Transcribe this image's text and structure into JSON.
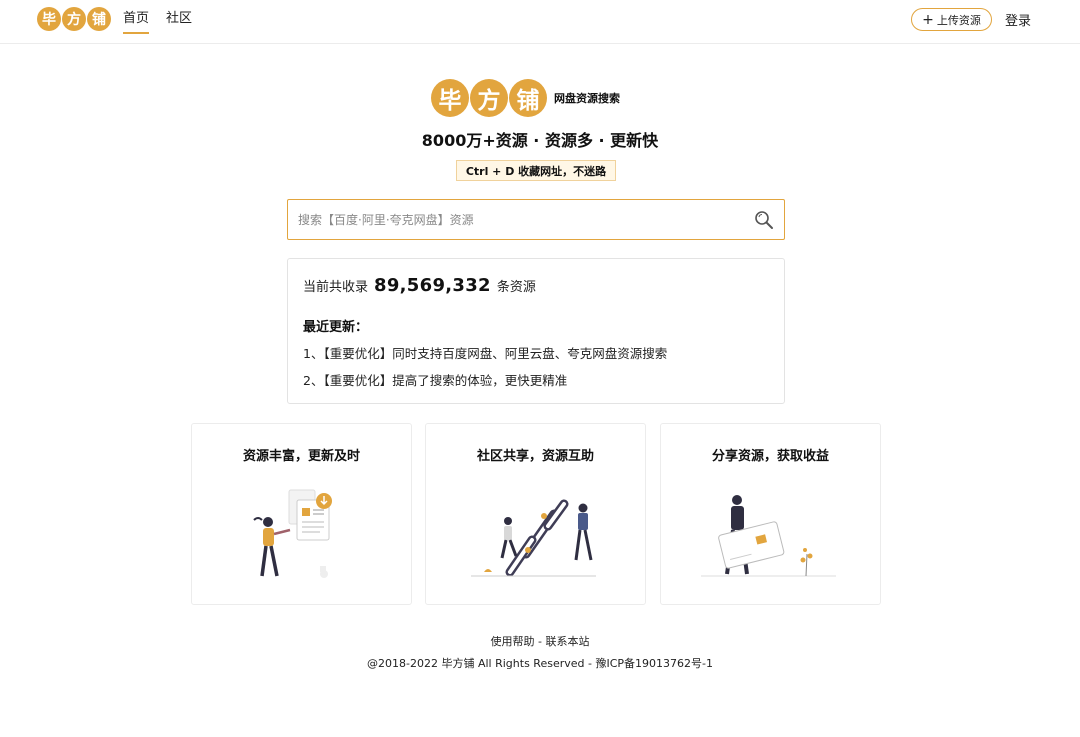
{
  "header": {
    "logo_chars": [
      "毕",
      "方",
      "铺"
    ],
    "nav": [
      {
        "label": "首页",
        "active": true
      },
      {
        "label": "社区",
        "active": false
      }
    ],
    "upload_label": "上传资源",
    "login_label": "登录"
  },
  "hero": {
    "logo_chars": [
      "毕",
      "方",
      "铺"
    ],
    "logo_sub": "网盘资源搜索",
    "slogan": "8000万+资源 · 资源多 · 更新快",
    "bookmark_tip": "Ctrl + D 收藏网址，不迷路"
  },
  "search": {
    "placeholder": "搜索【百度·阿里·夸克网盘】资源",
    "value": ""
  },
  "stats": {
    "prefix": "当前共收录",
    "count": "89,569,332",
    "suffix": "条资源",
    "recent_title": "最近更新：",
    "news": [
      "1、【重要优化】同时支持百度网盘、阿里云盘、夸克网盘资源搜索",
      "2、【重要优化】提高了搜索的体验，更快更精准"
    ]
  },
  "features": [
    {
      "title": "资源丰富，更新及时"
    },
    {
      "title": "社区共享，资源互助"
    },
    {
      "title": "分享资源，获取收益"
    }
  ],
  "footer": {
    "help": "使用帮助",
    "separator": " - ",
    "contact": "联系本站",
    "copyright": "@2018-2022 毕方铺 All Rights Reserved - ",
    "icp": "豫ICP备19013762号-1"
  },
  "colors": {
    "accent": "#e2a53e",
    "accent_light": "#fff7e6"
  }
}
